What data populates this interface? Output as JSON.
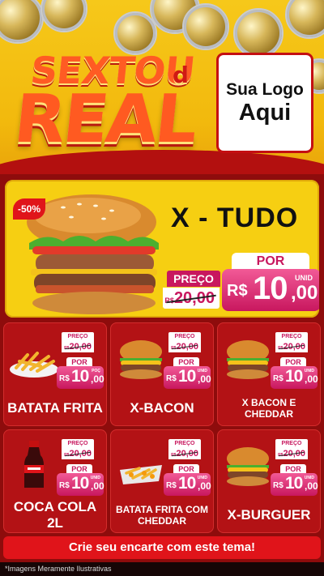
{
  "header": {
    "title_line1": "SEXTOU",
    "title_connector": "d",
    "title_line2": "REAL",
    "logo_line1": "Sua Logo",
    "logo_line2": "Aqui"
  },
  "featured": {
    "discount": "-50%",
    "name": "X - TUDO",
    "preco_label": "PREÇO",
    "old_currency": "R$",
    "old_price": "20,00",
    "por_label": "POR",
    "unit": "UNID",
    "currency": "R$",
    "price_int": "10",
    "price_cents": ",00"
  },
  "price_common": {
    "preco_label": "PREÇO",
    "old_currency": "R$",
    "old_price": "20,00",
    "por_label": "POR",
    "currency": "R$",
    "price_int": "10",
    "price_cents": ",00"
  },
  "products": [
    {
      "name": "BATATA FRITA",
      "unit": "POÇ",
      "food_icon": "fries-icon"
    },
    {
      "name": "X-BACON",
      "unit": "UNID",
      "food_icon": "burger-icon"
    },
    {
      "name": "X BACON E CHEDDAR",
      "unit": "UNID",
      "food_icon": "burger-icon"
    },
    {
      "name": "COCA COLA 2L",
      "unit": "UNID",
      "food_icon": "soda-bottle-icon"
    },
    {
      "name": "BATATA FRITA COM CHEDDAR",
      "unit": "UNID",
      "food_icon": "fries-cheddar-icon"
    },
    {
      "name": "X-BURGUER",
      "unit": "UNID",
      "food_icon": "burger-icon"
    }
  ],
  "cta": "Crie seu encarte com este tema!",
  "footer_note": "*Imagens Meramente Ilustrativas",
  "colors": {
    "yellow": "#f6cf12",
    "red": "#b31215",
    "dark_red": "#8e0c0c",
    "pink": "#c8175e",
    "cta_red": "#e0141a"
  }
}
